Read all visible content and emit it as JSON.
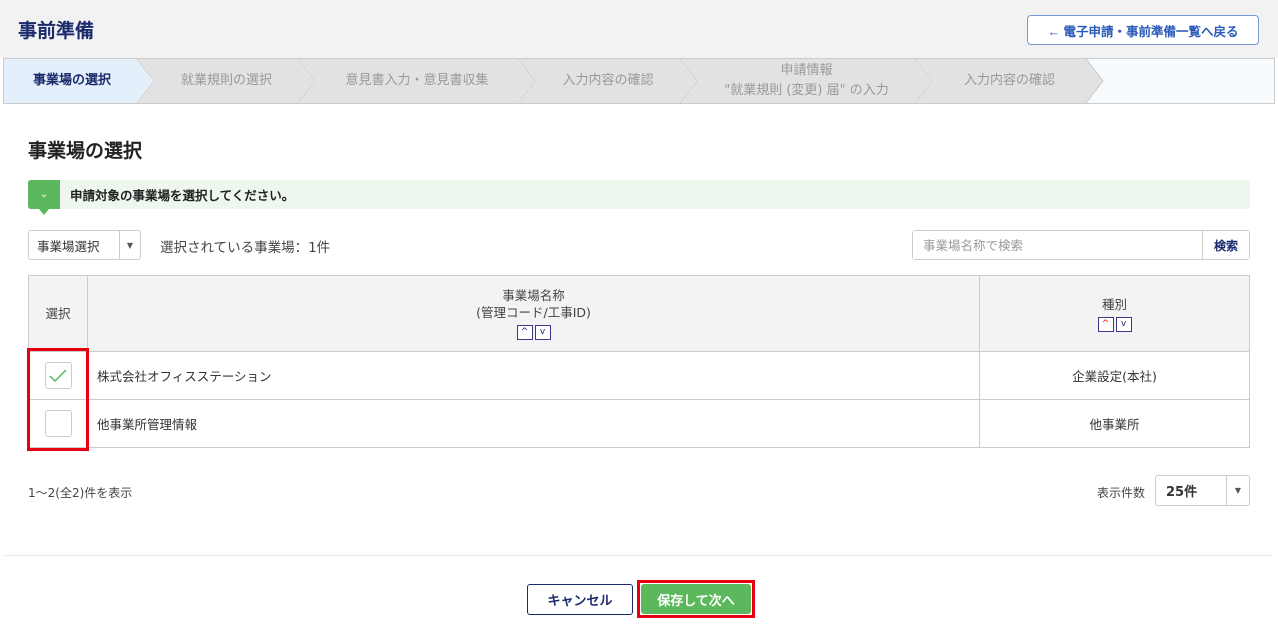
{
  "header": {
    "title": "事前準備",
    "back_button": "← 電子申請・事前準備一覧へ戻る"
  },
  "steps": [
    {
      "label": "事業場の選択",
      "active": true
    },
    {
      "label": "就業規則の選択"
    },
    {
      "label": "意見書入力・意見書収集"
    },
    {
      "label": "入力内容の確認"
    },
    {
      "label": "申請情報",
      "label2": "\"就業規則 (変更) 届\" の入力"
    },
    {
      "label": "入力内容の確認"
    }
  ],
  "section_title": "事業場の選択",
  "notice": "申請対象の事業場を選択してください。",
  "select_dropdown": "事業場選択",
  "selected_count": "選択されている事業場：1件",
  "search": {
    "placeholder": "事業場名称で検索",
    "button": "検索"
  },
  "table": {
    "headers": {
      "select": "選択",
      "name": "事業場名称",
      "name_sub": "(管理コード/工事ID)",
      "type": "種別"
    },
    "rows": [
      {
        "name": "株式会社オフィスステーション",
        "type": "企業設定(本社)",
        "checked": true
      },
      {
        "name": "他事業所管理情報",
        "type": "他事業所",
        "checked": false
      }
    ]
  },
  "range_text": "1〜2(全2)件を表示",
  "per_page": {
    "label": "表示件数",
    "value": "25件"
  },
  "buttons": {
    "cancel": "キャンセル",
    "save": "保存して次へ"
  },
  "colors": {
    "accent": "#5cb85c",
    "highlight": "#e60012",
    "navy": "#1a2a6c"
  }
}
